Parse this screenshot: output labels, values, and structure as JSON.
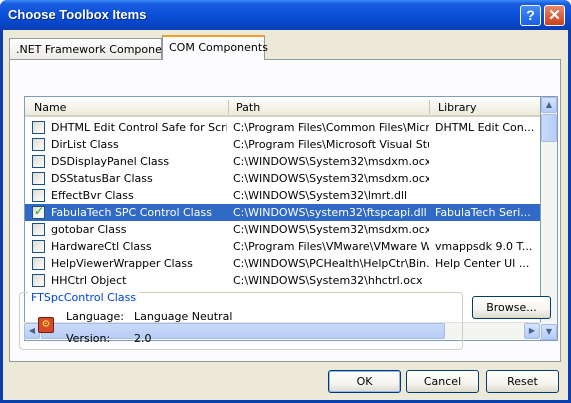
{
  "window": {
    "title": "Choose Toolbox Items",
    "help_label": "?",
    "close_label": "✕"
  },
  "tabs": [
    {
      "label": ".NET Framework Components"
    },
    {
      "label": "COM Components"
    }
  ],
  "list": {
    "columns": [
      "Name",
      "Path",
      "Library"
    ],
    "rows": [
      {
        "checked": false,
        "name": "DHTML Edit Control Safe for Scrip...",
        "path": "C:\\Program Files\\Common Files\\Micro...",
        "library": "DHTML Edit Con..."
      },
      {
        "checked": false,
        "name": "DirList Class",
        "path": "C:\\Program Files\\Microsoft Visual Stu...",
        "library": ""
      },
      {
        "checked": false,
        "name": "DSDisplayPanel Class",
        "path": "C:\\WINDOWS\\System32\\msdxm.ocx",
        "library": ""
      },
      {
        "checked": false,
        "name": "DSStatusBar Class",
        "path": "C:\\WINDOWS\\System32\\msdxm.ocx",
        "library": ""
      },
      {
        "checked": false,
        "name": "EffectBvr Class",
        "path": "C:\\WINDOWS\\System32\\lmrt.dll",
        "library": ""
      },
      {
        "checked": true,
        "name": "FabulaTech SPC Control Class",
        "path": "C:\\WINDOWS\\system32\\ftspcapi.dll",
        "library": "FabulaTech Seri..."
      },
      {
        "checked": false,
        "name": "gotobar Class",
        "path": "C:\\WINDOWS\\System32\\msdxm.ocx",
        "library": ""
      },
      {
        "checked": false,
        "name": "HardwareCtl Class",
        "path": "C:\\Program Files\\VMware\\VMware W...",
        "library": "vmappsdk 9.0 T..."
      },
      {
        "checked": false,
        "name": "HelpViewerWrapper Class",
        "path": "C:\\WINDOWS\\PCHealth\\HelpCtr\\Bin...",
        "library": "Help Center UI ..."
      },
      {
        "checked": false,
        "name": "HHCtrl Object",
        "path": "C:\\WINDOWS\\System32\\hhctrl.ocx",
        "library": ""
      }
    ],
    "selected_index": 5
  },
  "details": {
    "group_title": "FTSpcControl Class",
    "language_label": "Language:",
    "language_value": "Language Neutral",
    "version_label": "Version:",
    "version_value": "2.0"
  },
  "buttons": {
    "browse": "Browse...",
    "ok": "OK",
    "cancel": "Cancel",
    "reset": "Reset"
  },
  "colors": {
    "titlebar": "#0a4fd8",
    "selection": "#316ac5",
    "group_title": "#0046d5",
    "active_tab_accent": "#f0a020"
  }
}
